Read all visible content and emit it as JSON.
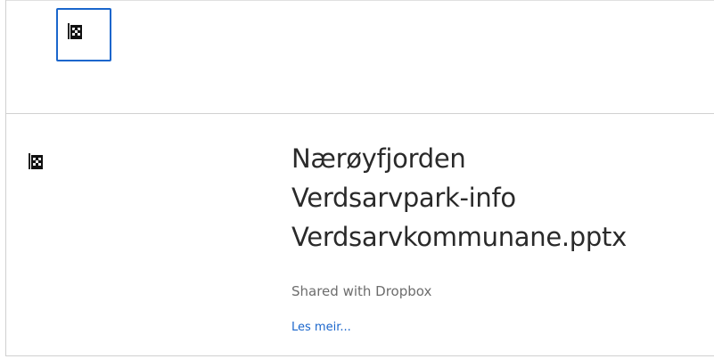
{
  "header": {
    "icon": "broken-image-icon"
  },
  "item": {
    "icon": "broken-image-icon",
    "title_lines": [
      "Nærøyfjorden",
      "Verdsarvpark-info",
      "Verdsarvkommunane.pptx"
    ],
    "subtitle": "Shared with Dropbox",
    "link_label": "Les meir..."
  },
  "colors": {
    "focus": "#1a66cc",
    "link": "#1a66cc",
    "subtitle": "#6d6d6d",
    "title": "#2a2a2a"
  }
}
